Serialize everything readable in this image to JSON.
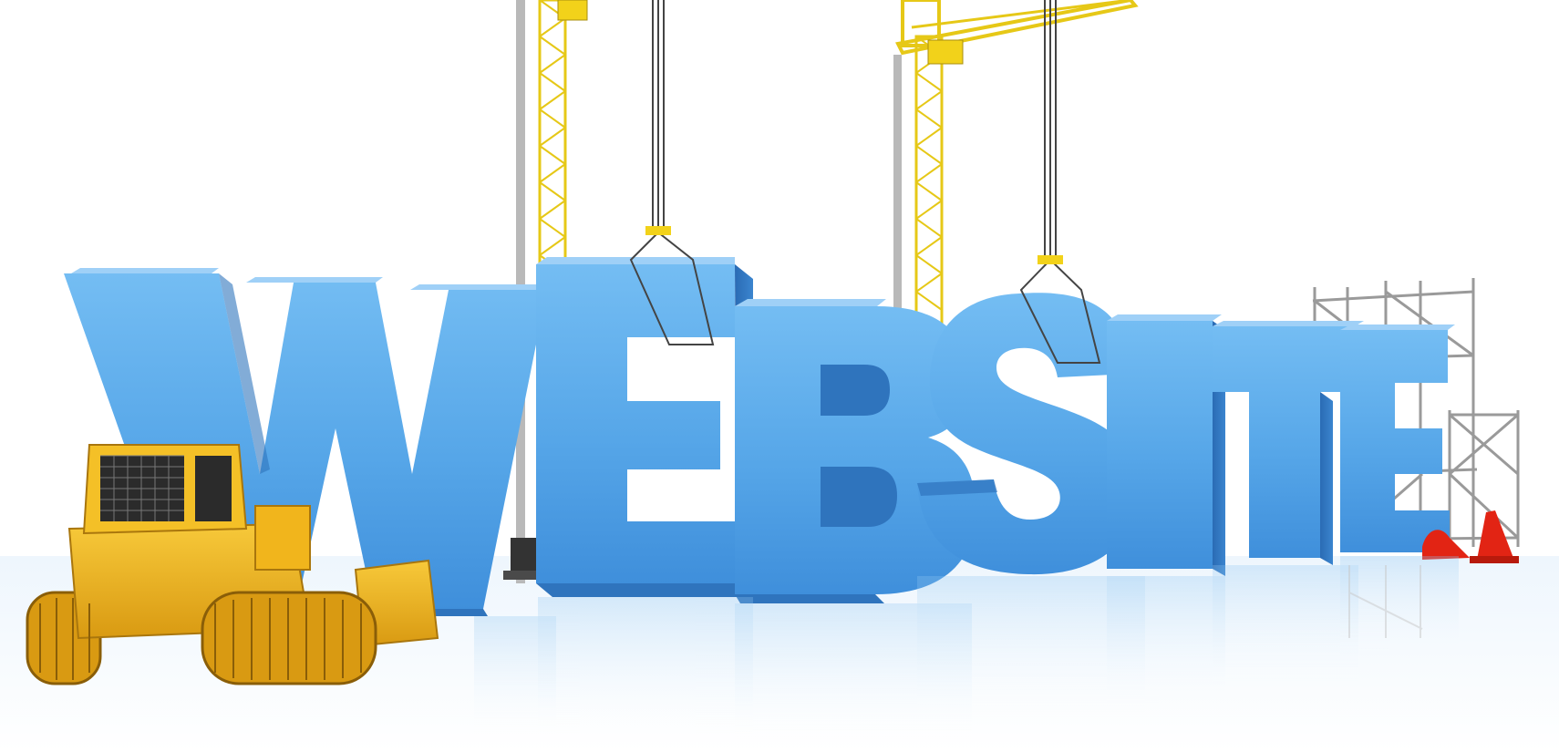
{
  "scene": {
    "headline": "WEBSITE",
    "letters": [
      "W",
      "E",
      "B",
      "S",
      "I",
      "T",
      "E"
    ],
    "colors": {
      "letter_face": "#5aaaea",
      "letter_side": "#2f74bd",
      "letter_top": "#9fd0f7",
      "crane": "#f2d21a",
      "bulldozer": "#f1b51c",
      "scaffold": "#9a9a9a",
      "cone": "#e22414",
      "background": "#ffffff"
    },
    "objects": [
      "bulldozer",
      "tower-crane-left",
      "tower-crane-right",
      "scaffolding",
      "traffic-cone",
      "lifting-cables"
    ]
  }
}
